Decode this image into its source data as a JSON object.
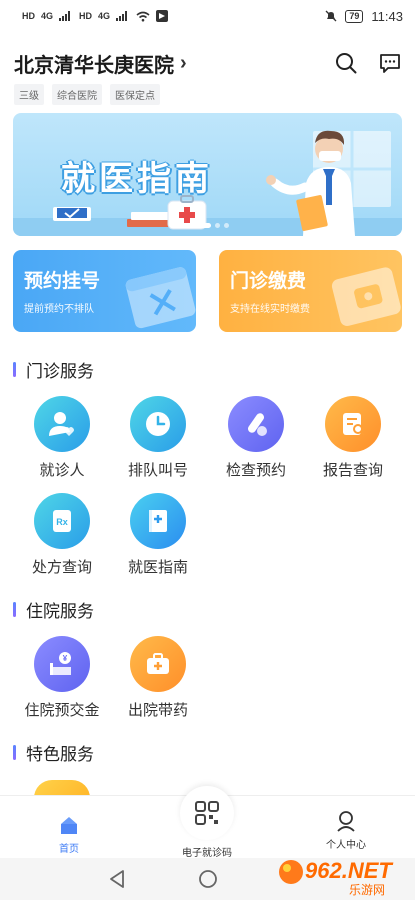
{
  "status_bar": {
    "left_labels": [
      "HD",
      "4G",
      "HD",
      "4G"
    ],
    "battery": "79",
    "time": "11:43"
  },
  "header": {
    "title": "北京清华长庚医院",
    "chevron": "›",
    "tags": [
      "三级",
      "综合医院",
      "医保定点"
    ],
    "icons": [
      "search-icon",
      "message-icon"
    ]
  },
  "banner": {
    "title": "就医指南",
    "dots": 3,
    "active_dot": 0
  },
  "quick_cards": [
    {
      "title": "预约挂号",
      "subtitle": "提前预约不排队",
      "color": "#4aa7f5"
    },
    {
      "title": "门诊缴费",
      "subtitle": "支持在线实时缴费",
      "color": "#ffb141"
    }
  ],
  "sections": {
    "outpatient": {
      "title": "门诊服务",
      "items": [
        {
          "label": "就诊人",
          "icon": "patient-icon"
        },
        {
          "label": "排队叫号",
          "icon": "clock-icon"
        },
        {
          "label": "检查预约",
          "icon": "test-tube-icon"
        },
        {
          "label": "报告查询",
          "icon": "report-search-icon"
        },
        {
          "label": "处方查询",
          "icon": "prescription-icon"
        },
        {
          "label": "就医指南",
          "icon": "guide-book-icon"
        }
      ]
    },
    "inpatient": {
      "title": "住院服务",
      "items": [
        {
          "label": "住院预交金",
          "icon": "deposit-icon"
        },
        {
          "label": "出院带药",
          "icon": "medicine-kit-icon"
        }
      ]
    },
    "special": {
      "title": "特色服务"
    }
  },
  "bottom_nav": {
    "home": "首页",
    "card": "电子就诊码",
    "profile": "个人中心"
  },
  "watermark": {
    "brand": "962.NET",
    "sub": "乐游网"
  },
  "colors": {
    "accent": "#3f7cf5",
    "blue_card": "#4aa7f5",
    "orange_card": "#ffb141"
  }
}
